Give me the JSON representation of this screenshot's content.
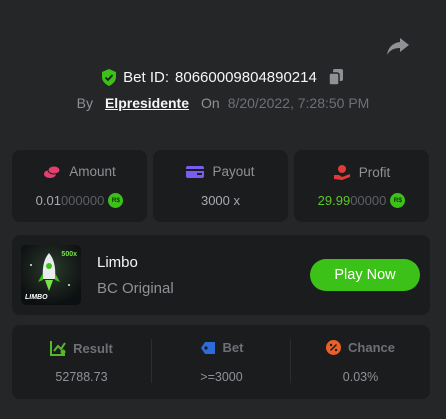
{
  "header": {
    "bet_id_label": "Bet ID:",
    "bet_id_value": "80660009804890214",
    "by_label": "By",
    "username": "Elpresidente",
    "on_label": "On",
    "date": "8/20/2022, 7:28:50 PM"
  },
  "stats": {
    "amount": {
      "label": "Amount",
      "value_main": "0.01",
      "value_dim": "000000",
      "coin": "R$"
    },
    "payout": {
      "label": "Payout",
      "value": "3000 x"
    },
    "profit": {
      "label": "Profit",
      "value_main": "29.99",
      "value_dim": "00000",
      "coin": "R$"
    }
  },
  "game": {
    "name": "Limbo",
    "provider": "BC Original",
    "play_label": "Play Now",
    "thumb_text": "LIMBO",
    "thumb_badge": "500x"
  },
  "results": {
    "result": {
      "label": "Result",
      "value": "52788.73"
    },
    "bet": {
      "label": "Bet",
      "value": ">=3000"
    },
    "chance": {
      "label": "Chance",
      "value": "0.03%"
    }
  },
  "colors": {
    "accent_green": "#3bc117",
    "profit_green": "#5bc926",
    "amount_icon": "#e2406c",
    "payout_icon": "#7b5cf0",
    "profit_icon": "#e03a3a",
    "result_icon": "#56b82c",
    "bet_icon": "#2f6bd8",
    "chance_icon": "#e8602a"
  },
  "icons": [
    "share-icon",
    "shield-check-icon",
    "copy-icon",
    "coins-icon",
    "wallet-icon",
    "hand-coin-icon",
    "chart-icon",
    "ticket-icon",
    "percent-icon",
    "rocket-icon"
  ]
}
